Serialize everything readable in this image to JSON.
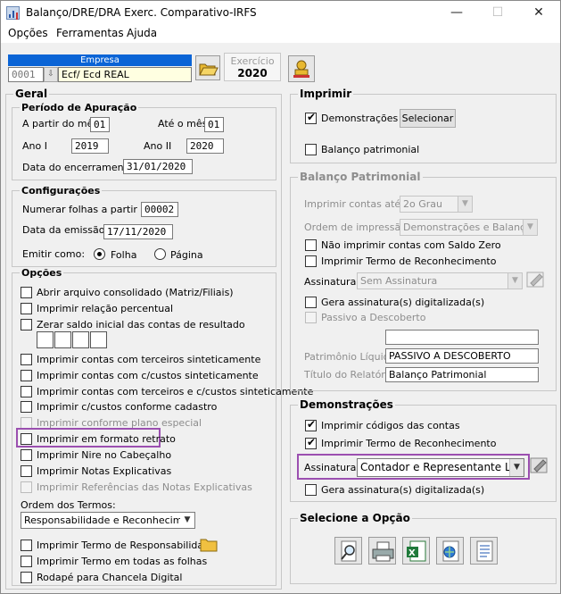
{
  "window": {
    "title": "Balanço/DRE/DRA Exerc. Comparativo-IRFS",
    "minimize": "—",
    "maximize": "☐",
    "close": "✕"
  },
  "menu": [
    "Opções",
    "Ferramentas",
    "Ajuda"
  ],
  "empresa": {
    "label": "Empresa",
    "code": "0001",
    "name": "Ecf/ Ecd REAL"
  },
  "exercicio": {
    "label": "Exercício",
    "value": "2020"
  },
  "geral": {
    "title": "Geral",
    "periodo": {
      "title": "Período de Apuração",
      "a_partir_label": "A partir do mês",
      "a_partir_value": "01",
      "ate_label": "Até o mês",
      "ate_value": "01",
      "ano1_label": "Ano I",
      "ano1_value": "2019",
      "ano2_label": "Ano II",
      "ano2_value": "2020",
      "data_enc_label": "Data do encerramento",
      "data_enc_value": "31/01/2020"
    },
    "config": {
      "title": "Configurações",
      "numerar_label": "Numerar folhas a partir de",
      "numerar_value": "00002",
      "data_emissao_label": "Data da emissão",
      "data_emissao_value": "17/11/2020",
      "emitir_label": "Emitir como:",
      "folha": "Folha",
      "pagina": "Página"
    },
    "opcoes": {
      "title": "Opções",
      "items": [
        "Abrir arquivo consolidado (Matriz/Filiais)",
        "Imprimir relação percentual",
        "Zerar saldo inicial das contas de resultado",
        "Imprimir contas com terceiros sinteticamente",
        "Imprimir contas com c/custos sinteticamente",
        "Imprimir contas com terceiros e c/custos sinteticamente",
        "Imprimir c/custos conforme cadastro",
        "Imprimir conforme plano especial",
        "Imprimir em formato retrato",
        "Imprimir Nire no Cabeçalho",
        "Imprimir Notas Explicativas",
        "Imprimir Referências das Notas Explicativas"
      ],
      "ordem_label": "Ordem dos Termos:",
      "ordem_value": "Responsabilidade e Reconhecimento",
      "termo_resp": "Imprimir Termo de Responsabilidade",
      "termo_todas": "Imprimir Termo em todas as folhas",
      "rodape": "Rodapé para Chancela Digital"
    }
  },
  "imprimir": {
    "title": "Imprimir",
    "demonstracoes": "Demonstrações",
    "selecionar": "Selecionar",
    "balanco": "Balanço patrimonial"
  },
  "balanco": {
    "title": "Balanço Patrimonial",
    "contas_label": "Imprimir contas até:",
    "contas_value": "2o Grau",
    "ordem_label": "Ordem de impressão:",
    "ordem_value": "Demonstrações e Balanço",
    "nao_saldo": "Não imprimir contas com Saldo Zero",
    "termo_rec": "Imprimir Termo de Reconhecimento",
    "assinatura_label": "Assinatura:",
    "assinatura_value": "Sem Assinatura",
    "gera_assinatura": "Gera assinatura(s) digitalizada(s)",
    "passivo": "Passivo a Descoberto",
    "patrimonio_label": "Patrimônio Líquido:",
    "patrimonio_value": "PASSIVO A DESCOBERTO",
    "titulo_label": "Título do Relatório:",
    "titulo_value": "Balanço Patrimonial"
  },
  "demonstracoes": {
    "title": "Demonstrações",
    "codigos": "Imprimir códigos das contas",
    "termo_rec": "Imprimir Termo de Reconhecimento",
    "assinatura_label": "Assinatura:",
    "assinatura_value": "Contador e Representante Legal",
    "gera_assinatura": "Gera assinatura(s) digitalizada(s)"
  },
  "selecione": {
    "title": "Selecione a Opção"
  }
}
